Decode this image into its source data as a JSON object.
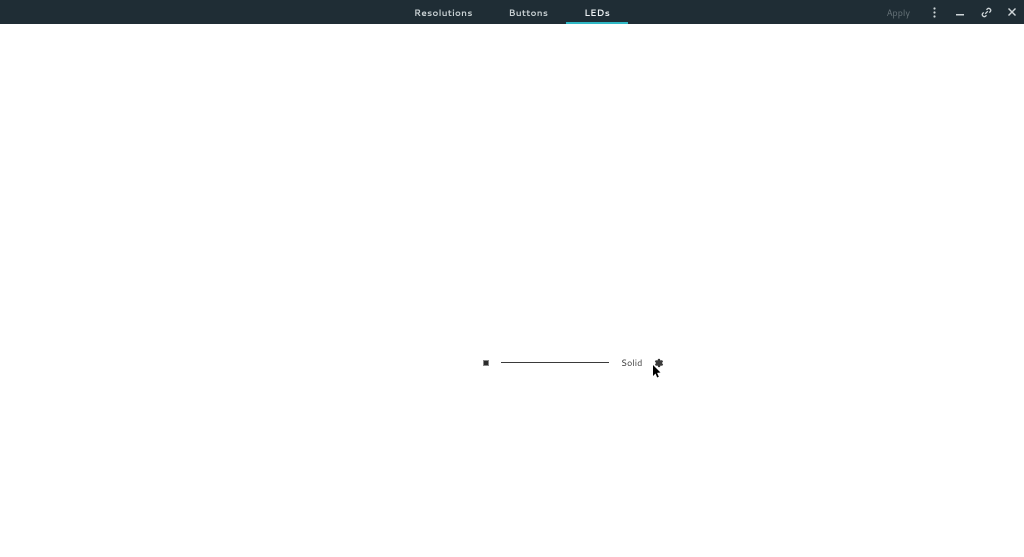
{
  "header": {
    "tabs": [
      {
        "label": "Resolutions",
        "active": false
      },
      {
        "label": "Buttons",
        "active": false
      },
      {
        "label": "LEDs",
        "active": true
      }
    ],
    "apply_label": "Apply"
  },
  "led": {
    "mode_label": "Solid",
    "swatch_color": "#2b2b2b"
  }
}
